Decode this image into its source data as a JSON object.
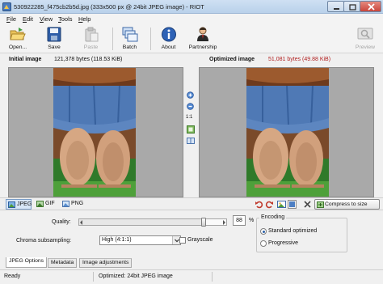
{
  "window": {
    "title": "530922285_f475cb2b5d.jpg (333x500 px @ 24bit JPEG image) - RIOT",
    "controls": [
      "minimize-icon",
      "maximize-icon",
      "close-icon"
    ],
    "close_color": "#c9463d"
  },
  "menu": [
    {
      "label": "File",
      "hotkey": "F",
      "rest": "ile"
    },
    {
      "label": "Edit",
      "hotkey": "E",
      "rest": "dit"
    },
    {
      "label": "View",
      "hotkey": "V",
      "rest": "iew"
    },
    {
      "label": "Tools",
      "hotkey": "T",
      "rest": "ools"
    },
    {
      "label": "Help",
      "hotkey": "H",
      "rest": "elp"
    }
  ],
  "toolbar": {
    "open": "Open...",
    "save": "Save",
    "paste": "Paste",
    "batch": "Batch",
    "about": "About",
    "partnership": "Partnership",
    "preview": "Preview"
  },
  "info": {
    "initial_label": "Initial image",
    "initial_size": "121,378 bytes (118.53 KiB)",
    "optimized_label": "Optimized image",
    "optimized_size": "51,081 bytes (49.88 KiB)",
    "optimized_color": "#b22222"
  },
  "view_tools": [
    "zoom-in-icon",
    "zoom-out-icon",
    "1:1",
    "fit-icon",
    "compare-icon"
  ],
  "view_ratio": "1:1",
  "formats": [
    {
      "label": "JPEG",
      "active": true
    },
    {
      "label": "GIF",
      "active": false
    },
    {
      "label": "PNG",
      "active": false
    }
  ],
  "actions": [
    "undo-icon",
    "redo-icon",
    "image-settings-icon",
    "background-icon",
    "close-file-icon"
  ],
  "compress_button": "Compress to size",
  "options": {
    "quality_label": "Quality:",
    "quality_value": "88",
    "quality_unit": "%",
    "quality_level": 0.88,
    "chroma_label": "Chroma subsampling:",
    "chroma_value": "High (4:1:1)",
    "grayscale_label": "Grayscale",
    "grayscale_checked": false,
    "encoding_title": "Encoding",
    "encoding_standard": "Standard optimized",
    "encoding_progressive": "Progressive",
    "encoding_selected": "Standard optimized"
  },
  "tabs": [
    {
      "label": "JPEG Options",
      "active": true
    },
    {
      "label": "Metadata",
      "active": false
    },
    {
      "label": "Image adjustments",
      "active": false
    }
  ],
  "status": {
    "left": "Ready",
    "right": "Optimized: 24bit JPEG image"
  },
  "colors": {
    "accent": "#2a5fa8",
    "pane_background": "#a9a9a9"
  }
}
